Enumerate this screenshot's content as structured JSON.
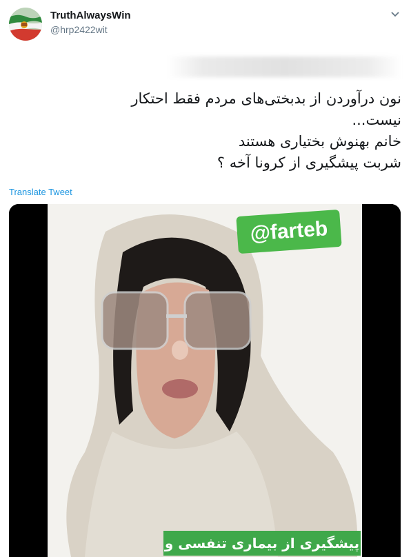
{
  "author": {
    "display_name": "TruthAlwaysWin",
    "handle": "@hrp2422wit"
  },
  "icons": {
    "avatar": "iran-flag-avatar",
    "menu": "chevron-down-icon"
  },
  "tweet": {
    "lines": [
      "نون درآوردن از بدبختی‌های مردم فقط احتکار",
      "نیست...",
      "خانم بهنوش بختیاری هستند",
      "شربت پیشگیری از کرونا آخه ؟"
    ],
    "translate_label": "Translate Tweet"
  },
  "media": {
    "watermark": "@farteb",
    "caption": "پیشگیری از بیماری تنفسی و"
  },
  "colors": {
    "link": "#1b95e0",
    "secondary_text": "#657786",
    "watermark_green": "#4bb84a"
  }
}
